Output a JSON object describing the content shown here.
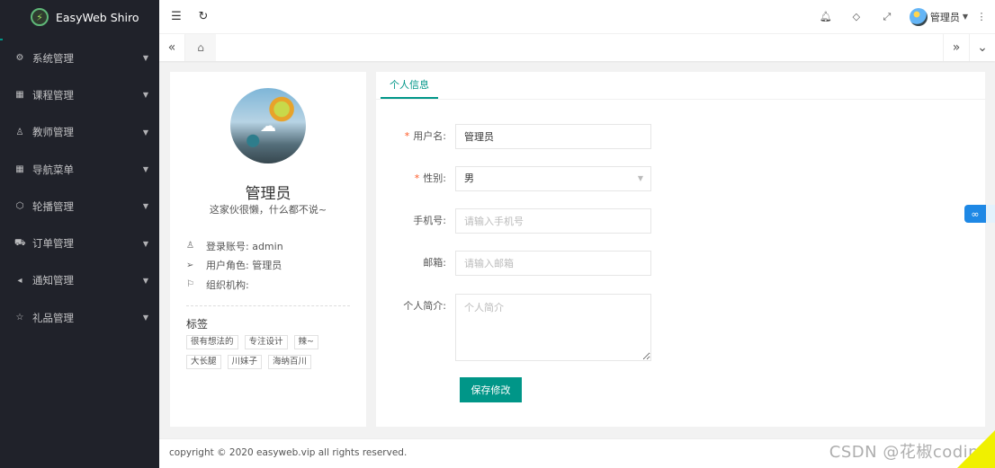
{
  "app": {
    "title": "EasyWeb Shiro"
  },
  "sidebar": {
    "items": [
      {
        "label": "系统管理",
        "icon": "gear-icon",
        "glyph": "⚙"
      },
      {
        "label": "课程管理",
        "icon": "apps-icon",
        "glyph": "▦"
      },
      {
        "label": "教师管理",
        "icon": "user-icon",
        "glyph": "♙"
      },
      {
        "label": "导航菜单",
        "icon": "apps-icon",
        "glyph": "▦"
      },
      {
        "label": "轮播管理",
        "icon": "cube-icon",
        "glyph": "⬡"
      },
      {
        "label": "订单管理",
        "icon": "cart-icon",
        "glyph": "⛟"
      },
      {
        "label": "通知管理",
        "icon": "speaker-icon",
        "glyph": "◂"
      },
      {
        "label": "礼品管理",
        "icon": "star-icon",
        "glyph": "☆"
      }
    ]
  },
  "header": {
    "user_name": "管理员"
  },
  "profile": {
    "name": "管理员",
    "signature": "这家伙很懒，什么都不说~",
    "account_label": "登录账号: admin",
    "role_label": "用户角色: 管理员",
    "org_label": "组织机构:",
    "tags_title": "标签",
    "tags": [
      "很有想法的",
      "专注设计",
      "辣~",
      "大长腿",
      "川妹子",
      "海纳百川"
    ]
  },
  "form": {
    "tab_label": "个人信息",
    "username_label": "用户名:",
    "username_value": "管理员",
    "gender_label": "性别:",
    "gender_value": "男",
    "phone_label": "手机号:",
    "phone_placeholder": "请输入手机号",
    "email_label": "邮箱:",
    "email_placeholder": "请输入邮箱",
    "intro_label": "个人简介:",
    "intro_placeholder": "个人简介",
    "save_label": "保存修改"
  },
  "footer": {
    "copyright": "copyright © 2020 easyweb.vip all rights reserved."
  },
  "watermark": {
    "text": "CSDN @花椒coding"
  },
  "colors": {
    "accent": "#009688",
    "sidebar_bg": "#20222a",
    "required": "#ff5722"
  }
}
